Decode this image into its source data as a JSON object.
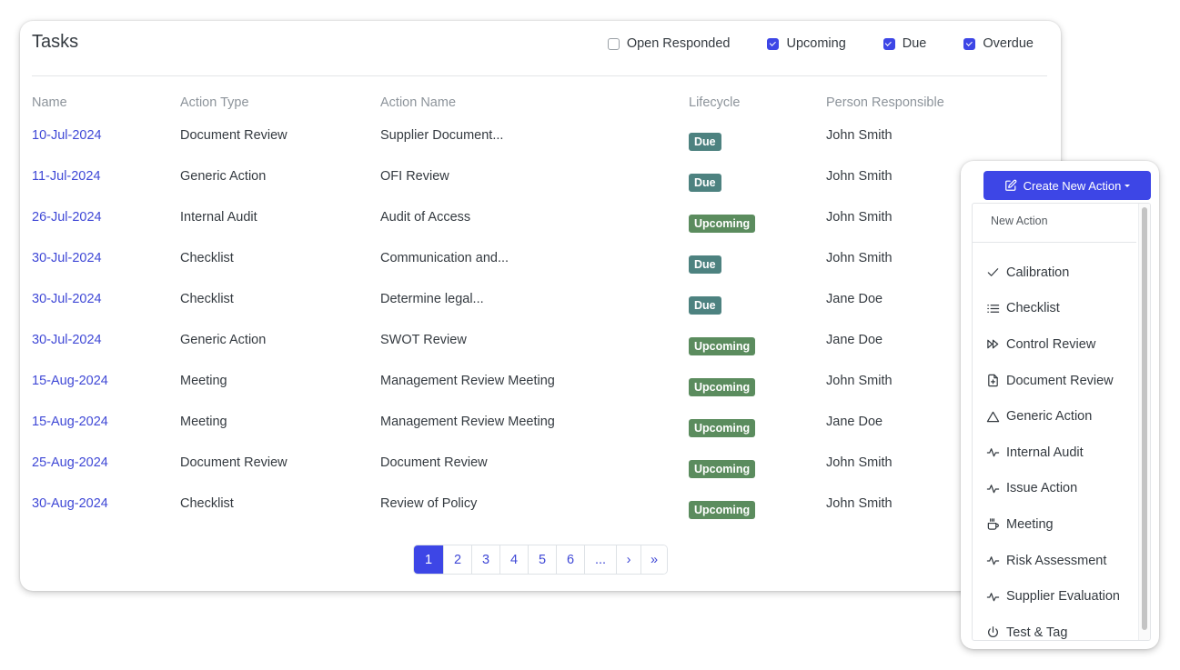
{
  "card": {
    "title": "Tasks",
    "filters": [
      {
        "label": "Open Responded",
        "checked": false
      },
      {
        "label": "Upcoming",
        "checked": true
      },
      {
        "label": "Due",
        "checked": true
      },
      {
        "label": "Overdue",
        "checked": true
      }
    ]
  },
  "table": {
    "columns": [
      "Name",
      "Action Type",
      "Action Name",
      "Lifecycle",
      "Person Responsible"
    ],
    "rows": [
      {
        "name": "10-Jul-2024",
        "type": "Document Review",
        "action": "Supplier Document...",
        "lifecycle": "Due",
        "person": "John Smith"
      },
      {
        "name": "11-Jul-2024",
        "type": "Generic Action",
        "action": "OFI Review",
        "lifecycle": "Due",
        "person": "John Smith"
      },
      {
        "name": "26-Jul-2024",
        "type": "Internal Audit",
        "action": "Audit of Access",
        "lifecycle": "Upcoming",
        "person": "John Smith"
      },
      {
        "name": "30-Jul-2024",
        "type": "Checklist",
        "action": "Communication and...",
        "lifecycle": "Due",
        "person": "John Smith"
      },
      {
        "name": "30-Jul-2024",
        "type": "Checklist",
        "action": "Determine legal...",
        "lifecycle": "Due",
        "person": "Jane Doe"
      },
      {
        "name": "30-Jul-2024",
        "type": "Generic Action",
        "action": "SWOT Review",
        "lifecycle": "Upcoming",
        "person": "Jane Doe"
      },
      {
        "name": "15-Aug-2024",
        "type": "Meeting",
        "action": "Management Review Meeting",
        "lifecycle": "Upcoming",
        "person": "John Smith"
      },
      {
        "name": "15-Aug-2024",
        "type": "Meeting",
        "action": "Management Review Meeting",
        "lifecycle": "Upcoming",
        "person": "Jane Doe"
      },
      {
        "name": "25-Aug-2024",
        "type": "Document Review",
        "action": "Document Review",
        "lifecycle": "Upcoming",
        "person": "John Smith"
      },
      {
        "name": "30-Aug-2024",
        "type": "Checklist",
        "action": "Review of Policy",
        "lifecycle": "Upcoming",
        "person": "John Smith"
      }
    ]
  },
  "pagination": {
    "current": "1",
    "pages": [
      "1",
      "2",
      "3",
      "4",
      "5",
      "6"
    ],
    "ellipsis": "...",
    "next": "›",
    "last": "»"
  },
  "colors": {
    "accent": "#3d46e6",
    "link": "#3f48d6",
    "due_badge": "#4d8280",
    "upcoming_badge": "#5b8c5e"
  },
  "background_fragment": "e",
  "popup": {
    "button_label": "Create New Action",
    "button_icon": "edit-icon",
    "menu_header": "New Action",
    "items": [
      {
        "label": "Calibration",
        "icon": "check-icon"
      },
      {
        "label": "Checklist",
        "icon": "list-icon"
      },
      {
        "label": "Control Review",
        "icon": "fast-forward-icon"
      },
      {
        "label": "Document Review",
        "icon": "file-plus-icon"
      },
      {
        "label": "Generic Action",
        "icon": "triangle-icon"
      },
      {
        "label": "Internal Audit",
        "icon": "activity-icon"
      },
      {
        "label": "Issue Action",
        "icon": "activity-icon"
      },
      {
        "label": "Meeting",
        "icon": "coffee-icon"
      },
      {
        "label": "Risk Assessment",
        "icon": "activity-icon"
      },
      {
        "label": "Supplier Evaluation",
        "icon": "activity-icon"
      },
      {
        "label": "Test & Tag",
        "icon": "power-icon"
      }
    ]
  }
}
